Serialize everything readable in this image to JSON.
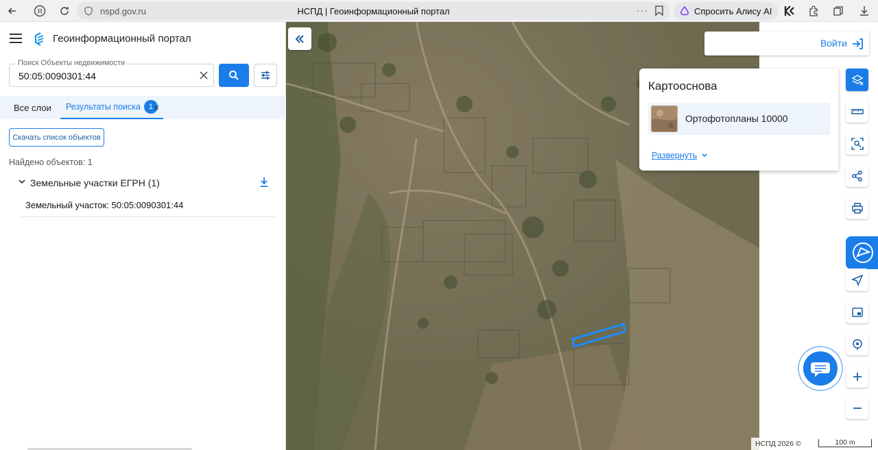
{
  "browser": {
    "url": "nspd.gov.ru",
    "tab_title": "НСПД | Геоинформационный портал",
    "more": "···",
    "alice_label": "Спросить Алису AI"
  },
  "sidebar": {
    "title": "Геоинформационный портал",
    "search": {
      "label": "Поиск Объекты недвижимости",
      "value": "50:05:0090301:44"
    },
    "tabs": {
      "all_layers": "Все слои",
      "results": "Результаты поиска",
      "results_count": "1",
      "close": "×"
    },
    "download_list_label": "Скачать список объектов",
    "found_text": "Найдено объектов: 1",
    "group_label": "Земельные участки ЕГРН (1)",
    "result_item": "Земельный участок: 50:05:0090301:44"
  },
  "map": {
    "login_label": "Войти",
    "basemap": {
      "title": "Картооснова",
      "item_label": "Ортофотопланы 10000",
      "expand_label": "Развернуть"
    },
    "footer": {
      "copyright": "НСПД 2026 ©",
      "scale": "100 m"
    },
    "tools": [
      "select-icon",
      "ruler-icon",
      "area-select-icon",
      "share-icon",
      "print-icon",
      "assistant-icon",
      "location-icon",
      "inset-map-icon",
      "geolocation-icon",
      "zoom-in-icon",
      "zoom-out-icon"
    ],
    "accent_color": "#1a7dea",
    "highlight_color": "#1a8cff"
  }
}
